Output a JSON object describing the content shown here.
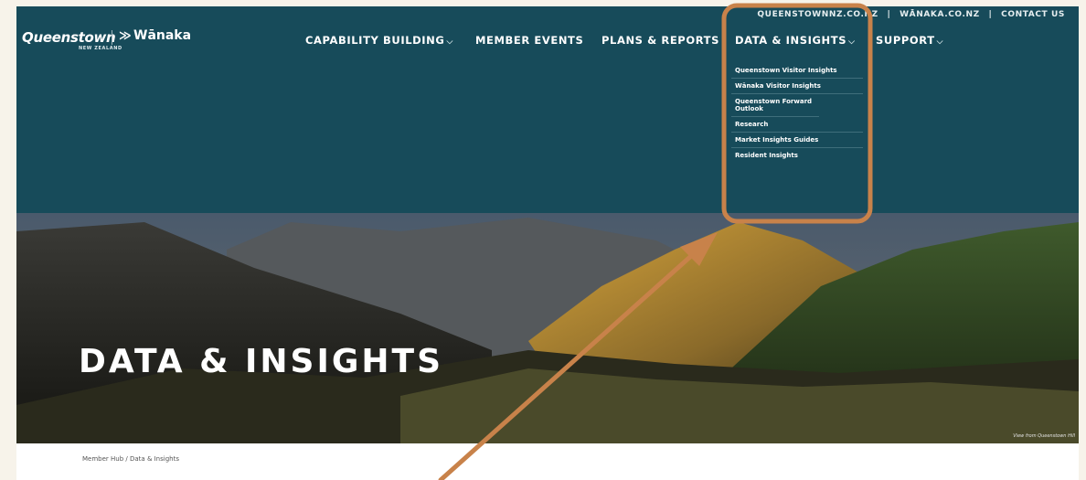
{
  "utility_nav": {
    "link1": "QUEENSTOWNNZ.CO.NZ",
    "separator": "|",
    "link2": "WĀNAKA.CO.NZ",
    "link3": "CONTACT US"
  },
  "logo": {
    "primary": "Queenstown",
    "primary_sub": "NEW ZEALAND",
    "secondary_mark": "≫",
    "secondary": "Wānaka"
  },
  "nav": {
    "items": [
      {
        "label": "CAPABILITY BUILDING",
        "chevron": "⌵"
      },
      {
        "label": "MEMBER EVENTS"
      },
      {
        "label": "PLANS & REPORTS"
      },
      {
        "label": "DATA & INSIGHTS",
        "chevron": "⌵"
      },
      {
        "label": "SUPPORT",
        "chevron": "⌵"
      }
    ]
  },
  "dropdown": {
    "items": [
      "Queenstown Visitor Insights",
      "Wānaka Visitor Insights",
      "Queenstown Forward Outlook",
      "Research",
      "Market Insights Guides",
      "Resident Insights"
    ]
  },
  "hero": {
    "title": "DATA & INSIGHTS",
    "caption": "View from Queenstown Hill"
  },
  "breadcrumb": {
    "home": "Member Hub",
    "separator": "/",
    "current": "Data & Insights"
  },
  "colors": {
    "header_bg": "#174b5a",
    "annotation": "#c8824a"
  }
}
